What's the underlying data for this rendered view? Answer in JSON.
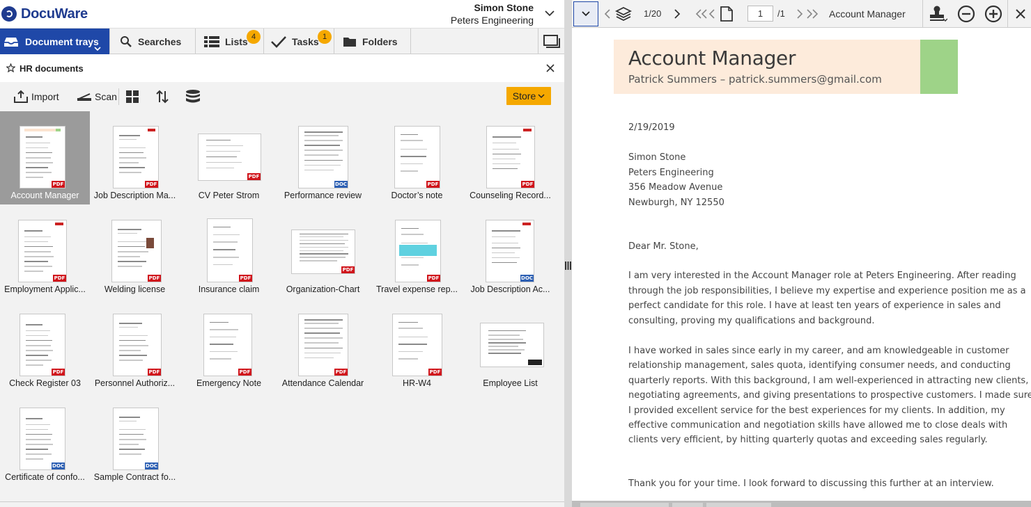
{
  "app": {
    "logo": "DocuWare"
  },
  "user": {
    "name": "Simon Stone",
    "company": "Peters Engineering"
  },
  "tabs": [
    {
      "label": "Document trays",
      "active": true
    },
    {
      "label": "Searches"
    },
    {
      "label": "Lists",
      "badge": "4"
    },
    {
      "label": "Tasks",
      "badge": "1"
    },
    {
      "label": "Folders"
    }
  ],
  "tray": {
    "title": "HR documents"
  },
  "toolbar": {
    "import": "Import",
    "scan": "Scan",
    "store": "Store"
  },
  "documents": [
    {
      "label": "Account Manager",
      "type": "PDF"
    },
    {
      "label": "Job Description Ma...",
      "type": "PDF"
    },
    {
      "label": "CV Peter Strom",
      "type": "PDF"
    },
    {
      "label": "Performance review",
      "type": "DOC"
    },
    {
      "label": "Doctor’s note",
      "type": "PDF"
    },
    {
      "label": "Counseling Record...",
      "type": "PDF"
    },
    {
      "label": "Employment Applic...",
      "type": "PDF"
    },
    {
      "label": "Welding license",
      "type": "PDF"
    },
    {
      "label": "Insurance claim",
      "type": "PDF"
    },
    {
      "label": "Organization-Chart",
      "type": "PDF"
    },
    {
      "label": "Travel expense rep...",
      "type": "PDF"
    },
    {
      "label": "Job Description Ac...",
      "type": "DOC"
    },
    {
      "label": "Check Register 03",
      "type": "PDF"
    },
    {
      "label": "Personnel Authoriz...",
      "type": "PDF"
    },
    {
      "label": "Emergency Note",
      "type": "PDF"
    },
    {
      "label": "Attendance Calendar",
      "type": "PDF"
    },
    {
      "label": "HR-W4",
      "type": "PDF"
    },
    {
      "label": "Employee List",
      "type": ""
    },
    {
      "label": "Certificate of confo...",
      "type": "DOC"
    },
    {
      "label": "Sample Contract fo...",
      "type": "DOC"
    }
  ],
  "viewer": {
    "position": "1/20",
    "page": "1",
    "page_total": "/1",
    "title": "Account Manager"
  },
  "letter": {
    "heading": "Account Manager",
    "subheading": "Patrick Summers – patrick.summers@gmail.com",
    "date": "2/19/2019",
    "address": [
      "Simon Stone",
      "Peters Engineering",
      "356 Meadow Avenue",
      "Newburgh, NY 12550"
    ],
    "salutation": "Dear Mr. Stone,",
    "para1": [
      "I am very interested in the Account Manager role at Peters Engineering. After reading",
      "through the job responsibilities, I believe my expertise and experience position me as a",
      "perfect candidate for this role. I have at least ten years of experience in sales and",
      "consulting, proving my qualifications and background."
    ],
    "para2": [
      "I have worked in sales since early in my career, and am knowledgeable in customer",
      "relationship management, sales quota, identifying consumer needs, and conducting",
      "quarterly reports. With this background, I am well-experienced in attracting new clients,",
      "negotiating agreements, and giving presentations to prospective customers. I made sure",
      "I provided excellent service for the best experiences for my clients. In addition, my",
      "effective communication and negotiation skills have allowed me to close deals with",
      "clients very efficient, by hitting quarterly quotas and exceeding sales regularly."
    ],
    "para3": [
      "Thank you for your time. I look forward to discussing this further at an interview."
    ]
  },
  "colors": {
    "accent": "#1f48a8",
    "badge": "#f5a800",
    "pdf": "#d0141b",
    "doc": "#2c5fb3"
  }
}
